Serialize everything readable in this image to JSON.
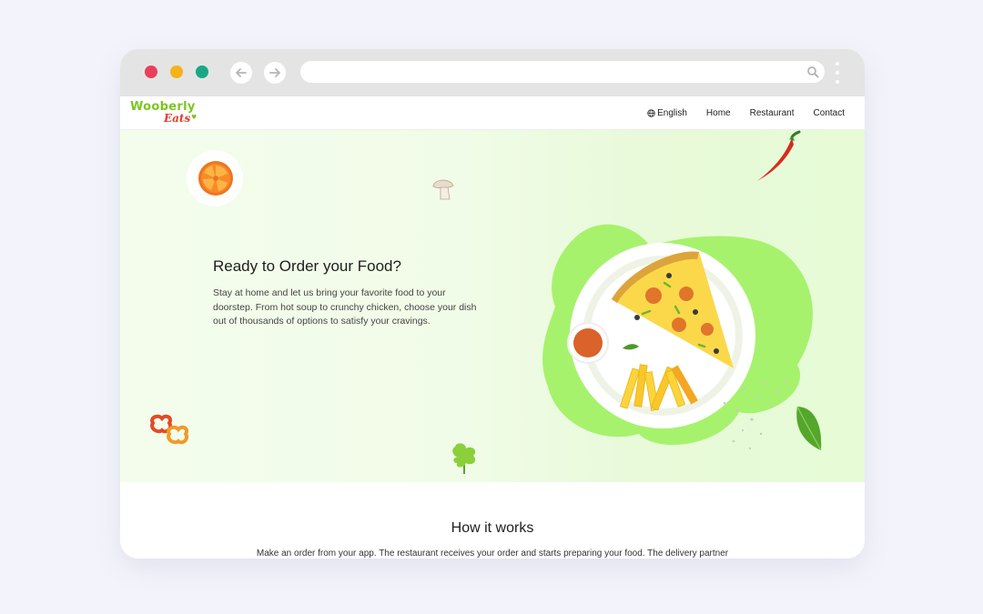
{
  "browser": {
    "address_value": "",
    "icons": [
      "arrow-left-icon",
      "arrow-right-icon",
      "search-icon",
      "kebab-menu-icon"
    ],
    "traffic_lights": [
      "#ea3f5a",
      "#f5b21b",
      "#1ba784"
    ]
  },
  "brand": {
    "name_line1": "Wooberly",
    "name_line2": "Eats",
    "colors": {
      "green": "#7cc61f",
      "red": "#e03c2b"
    }
  },
  "nav": {
    "language": "English",
    "items": [
      "Home",
      "Restaurant",
      "Contact"
    ]
  },
  "hero": {
    "title": "Ready to Order your Food?",
    "text": "Stay at home and let us bring your favorite food to your doorstep. From hot soup to crunchy chicken, choose your dish out of thousands of options to satisfy your cravings."
  },
  "how_it_works": {
    "title": "How it works",
    "text": "Make an order from your app. The restaurant receives your order and starts preparing your food. The delivery partner"
  }
}
